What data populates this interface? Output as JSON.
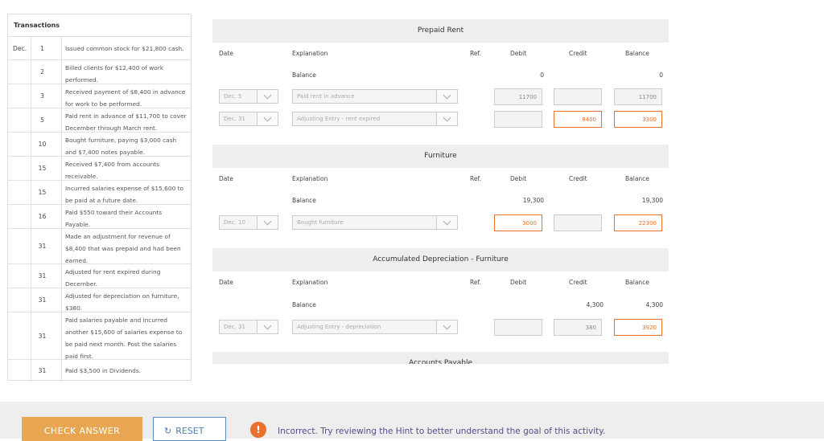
{
  "transactions": {
    "title": "Transactions",
    "rows": [
      {
        "month": "Dec.",
        "day": "1",
        "text": "Issued common stock for $21,800 cash."
      },
      {
        "month": "",
        "day": "2",
        "text": "Billed clients for $12,400 of work performed."
      },
      {
        "month": "",
        "day": "3",
        "text": "Received payment of $8,400 in advance for work to be performed."
      },
      {
        "month": "",
        "day": "5",
        "text": "Paid rent in advance of $11,700 to cover December through March rent."
      },
      {
        "month": "",
        "day": "10",
        "text": "Bought furniture, paying $3,000 cash and $7,400 notes payable."
      },
      {
        "month": "",
        "day": "15",
        "text": "Received $7,400 from accounts receivable."
      },
      {
        "month": "",
        "day": "15",
        "text": "Incurred salaries expense of $15,600 to be paid at a future date."
      },
      {
        "month": "",
        "day": "16",
        "text": "Paid $550 toward their Accounts Payable."
      },
      {
        "month": "",
        "day": "31",
        "text": "Made an adjustment for revenue of $8,400 that was prepaid and had been earned."
      },
      {
        "month": "",
        "day": "31",
        "text": "Adjusted for rent expired during December."
      },
      {
        "month": "",
        "day": "31",
        "text": "Adjusted for depreciation on furniture, $380."
      },
      {
        "month": "",
        "day": "31",
        "text": "Paid salaries payable and incurred another $15,600 of salaries expense to be paid next month. Post the salaries paid first."
      },
      {
        "month": "",
        "day": "31",
        "text": "Paid $3,500 in Dividends."
      }
    ]
  },
  "columns": {
    "date": "Date",
    "explanation": "Explanation",
    "ref": "Ref.",
    "debit": "Debit",
    "credit": "Credit",
    "balance": "Balance"
  },
  "ledgers": {
    "prepaid_rent": {
      "title": "Prepaid Rent",
      "opening": {
        "label": "Balance",
        "debit": "0",
        "balance": "0"
      },
      "entries": [
        {
          "date": "Dec. 5",
          "explanation": "Paid rent in advance",
          "debit": "11700",
          "credit": "",
          "balance": "11700"
        },
        {
          "date": "Dec. 31",
          "explanation": "Adjusting Entry - rent expired",
          "debit": "",
          "credit": "8400",
          "balance": "3300"
        }
      ]
    },
    "furniture": {
      "title": "Furniture",
      "opening": {
        "label": "Balance",
        "debit": "19,300",
        "balance": "19,300"
      },
      "entries": [
        {
          "date": "Dec. 10",
          "explanation": "Bought furniture",
          "debit": "3000",
          "credit": "",
          "balance": "22300"
        }
      ]
    },
    "accum_dep": {
      "title": "Accumulated Depreciation - Furniture",
      "opening": {
        "label": "Balance",
        "credit": "4,300",
        "balance": "4,300"
      },
      "entries": [
        {
          "date": "Dec. 31",
          "explanation": "Adjusting Entry - depreciation",
          "debit": "",
          "credit": "380",
          "balance": "3920"
        }
      ]
    },
    "accounts_payable": {
      "title": "Accounts Payable"
    }
  },
  "footer": {
    "check_label": "CHECK ANSWER",
    "reset_label": "RESET",
    "reset_icon": "refresh-icon",
    "warning_icon": "!",
    "message": "Incorrect. Try reviewing the Hint to better understand the goal of this activity."
  },
  "colors": {
    "accent": "#e8a652",
    "error": "#e8712d",
    "reset": "#4f7fb5",
    "message": "#5a4a8a"
  }
}
